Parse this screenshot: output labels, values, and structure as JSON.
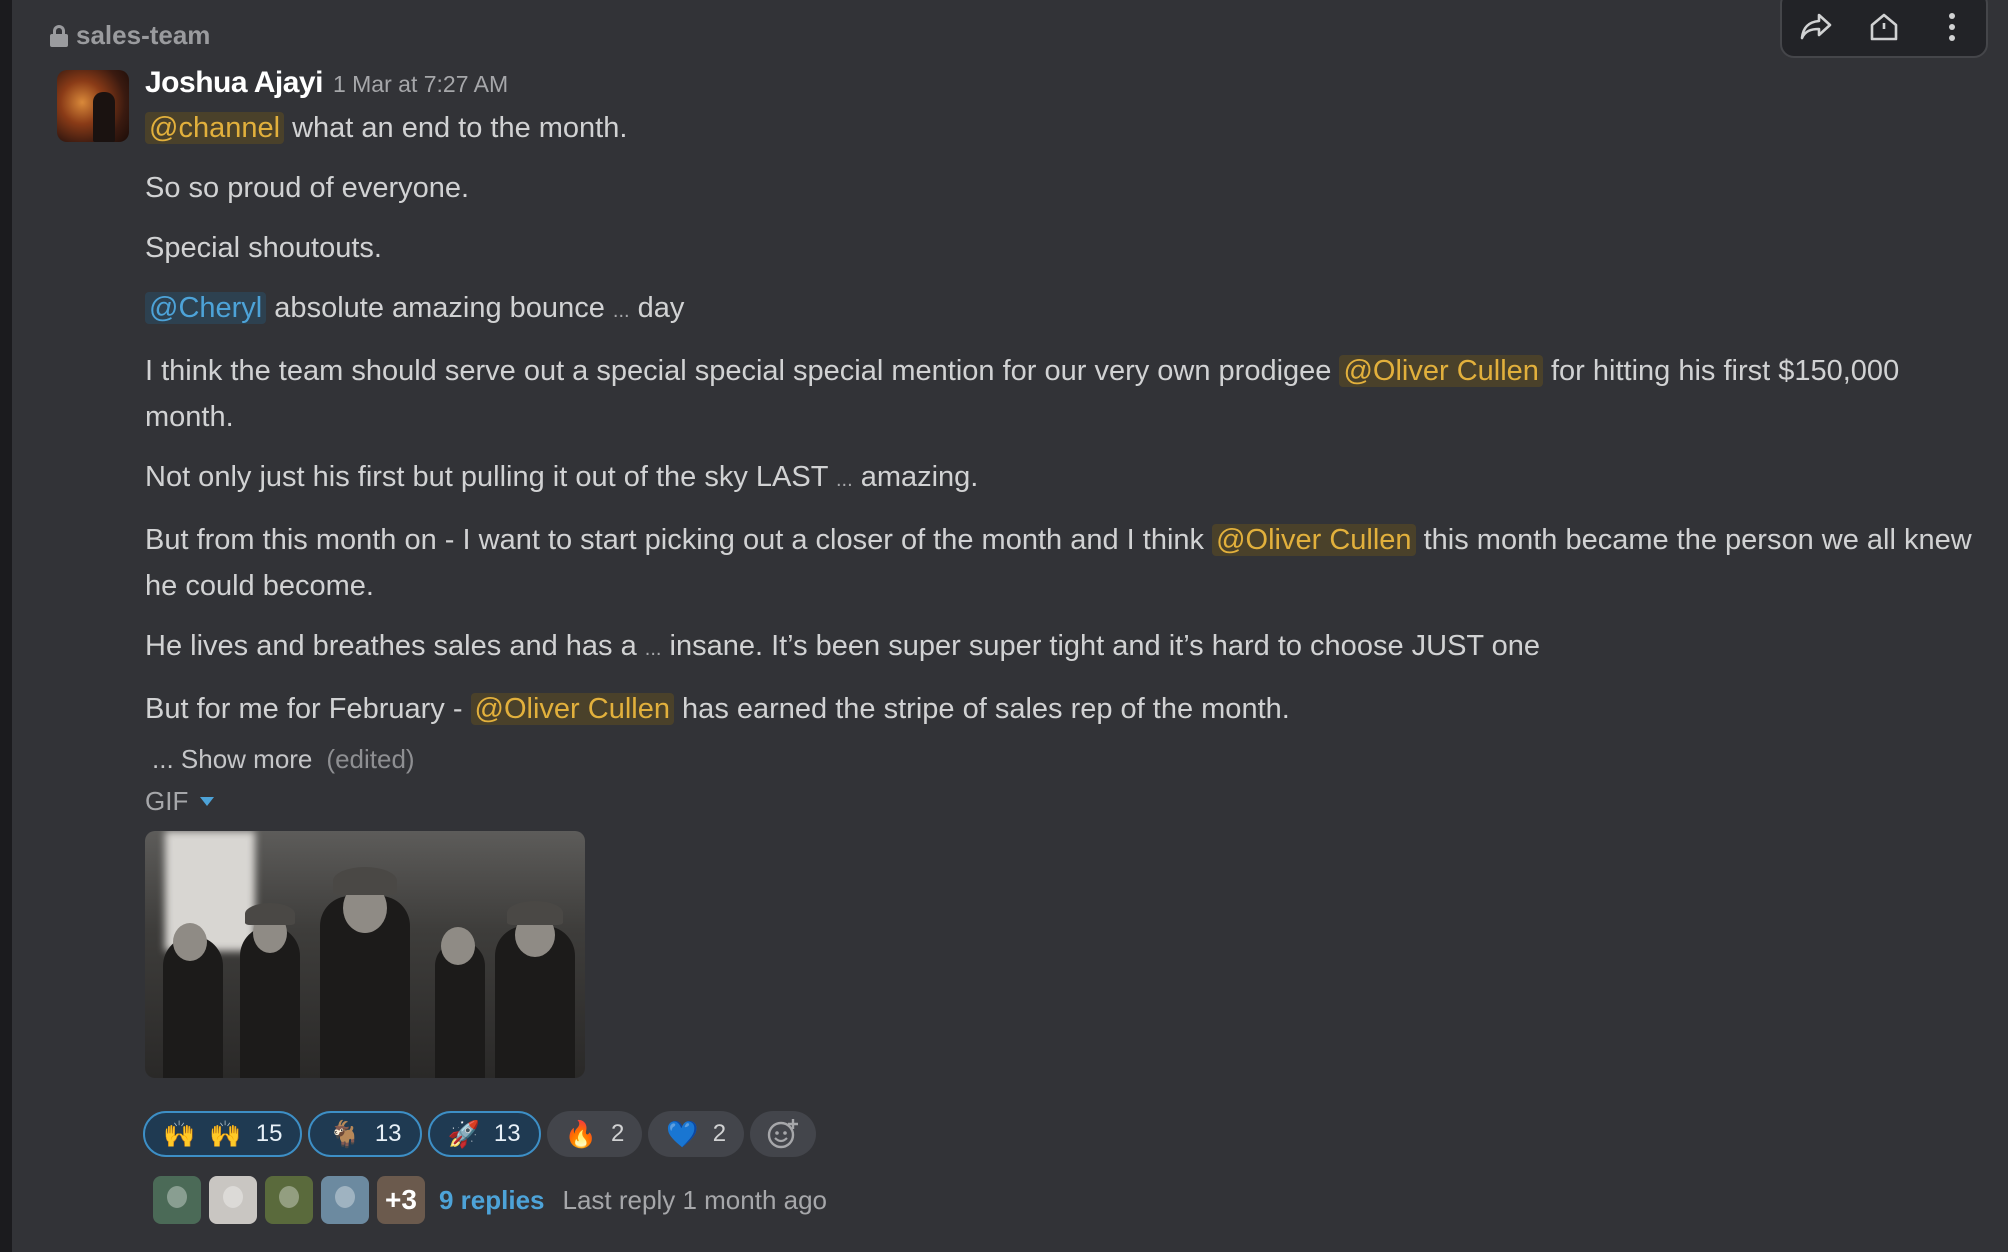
{
  "channel": {
    "name": "sales-team",
    "icon": "lock-icon"
  },
  "toolbar": {
    "actions": [
      "share-icon",
      "home-icon",
      "more-vertical-icon"
    ]
  },
  "message": {
    "author": "Joshua Ajayi",
    "timestamp": "1 Mar at 7:27 AM",
    "lines": {
      "l1_mention": "@channel",
      "l1_text": " what an end to the month.",
      "l2": "So so proud of everyone.",
      "l3": "Special shoutouts.",
      "l4_mention": "@Cheryl",
      "l4_text_a": " absolute amazing bounce ",
      "l4_ellipsis": "...",
      "l4_text_b": " day",
      "l5_text_a": "I think the team should serve out a special special special mention for our very own prodigee ",
      "l5_mention": "@Oliver Cullen",
      "l5_text_b": " for hitting his first $150,000 month.",
      "l6_text_a": "Not only just his first but pulling it out of the sky LAST ",
      "l6_ellipsis": "...",
      "l6_text_b": " amazing.",
      "l7_text_a": "But from this month on - I want to start picking out a closer of the month and I think ",
      "l7_mention": "@Oliver Cullen",
      "l7_text_b": " this month became the person we all knew he could become.",
      "l8_text_a": "He lives and breathes sales and has a ",
      "l8_ellipsis": "...",
      "l8_text_b": " insane. It’s been super super tight and it’s hard to choose JUST one",
      "l9_text_a": "But for me for February - ",
      "l9_mention": "@Oliver Cullen",
      "l9_text_b": " has earned the stripe of sales rep of the month."
    },
    "show_more": "... Show more",
    "edited": "(edited)",
    "attachment_label": "GIF"
  },
  "reactions": [
    {
      "emoji": "🙌",
      "emoji2": "🙌",
      "count": "15",
      "active": true
    },
    {
      "emoji": "🐐",
      "count": "13",
      "active": true
    },
    {
      "emoji": "🚀",
      "count": "13",
      "active": true
    },
    {
      "emoji": "🔥",
      "count": "2",
      "active": false
    },
    {
      "emoji": "💙",
      "count": "2",
      "active": false
    }
  ],
  "add_reaction_icon": "add-emoji-icon",
  "thread": {
    "more_count": "+3",
    "replies": "9 replies",
    "last_reply": "Last reply 1 month ago"
  },
  "colors": {
    "mention_highlight": "#e2b03c",
    "user_mention": "#4da3d8",
    "background": "#323337",
    "active_reaction": "#1f3a52"
  }
}
